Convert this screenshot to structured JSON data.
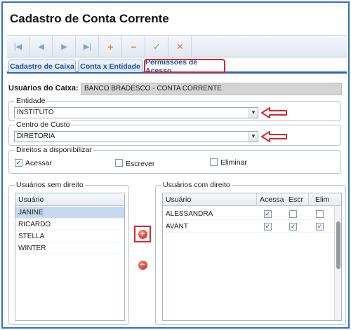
{
  "window": {
    "title": "Cadastro de Conta Corrente"
  },
  "toolbar": {
    "buttons": [
      {
        "icon": "first-record-icon",
        "glyph": "|◀"
      },
      {
        "icon": "previous-record-icon",
        "glyph": "◀"
      },
      {
        "icon": "next-record-icon",
        "glyph": "▶"
      },
      {
        "icon": "last-record-icon",
        "glyph": "▶|"
      },
      {
        "icon": "add-icon",
        "glyph": "+"
      },
      {
        "icon": "remove-icon",
        "glyph": "−"
      },
      {
        "icon": "confirm-icon",
        "glyph": "✓"
      },
      {
        "icon": "cancel-icon",
        "glyph": "✕"
      }
    ]
  },
  "tabs": [
    {
      "label": "Cadastro de Caixa"
    },
    {
      "label": "Conta x Entidade"
    },
    {
      "label": "Permissões de Acesso",
      "active": true
    }
  ],
  "caixa": {
    "label": "Usuários do Caixa:",
    "value": "BANCO BRADESCO - CONTA CORRENTE"
  },
  "entidade": {
    "legend": "Entidade",
    "value": "INSTITUTO"
  },
  "centro_custo": {
    "legend": "Centro de Custo",
    "value": "DIRETORIA"
  },
  "direitos": {
    "legend": "Direitos a disponibilizar",
    "acessar": {
      "label": "Acessar",
      "checked": true
    },
    "escrever": {
      "label": "Escrever",
      "checked": false
    },
    "eliminar": {
      "label": "Eliminar",
      "checked": false
    }
  },
  "sem_direito": {
    "legend": "Usuários sem direito",
    "column": "Usuário",
    "rows": [
      "JANINE",
      "RICARDO",
      "STELLA",
      "WINTER"
    ]
  },
  "com_direito": {
    "legend": "Usuários com direito",
    "columns": [
      "Usuário",
      "Acessa",
      "Escr",
      "Elim"
    ],
    "rows": [
      {
        "usuario": "ALESSANDRA",
        "acessa": true,
        "escr": false,
        "elim": false
      },
      {
        "usuario": "AVANT",
        "acessa": true,
        "escr": true,
        "elim": true
      }
    ]
  },
  "movers": {
    "add_glyph": "+",
    "remove_glyph": "−"
  },
  "colors": {
    "highlight": "#d8262a",
    "accent": "#2c62b8"
  }
}
